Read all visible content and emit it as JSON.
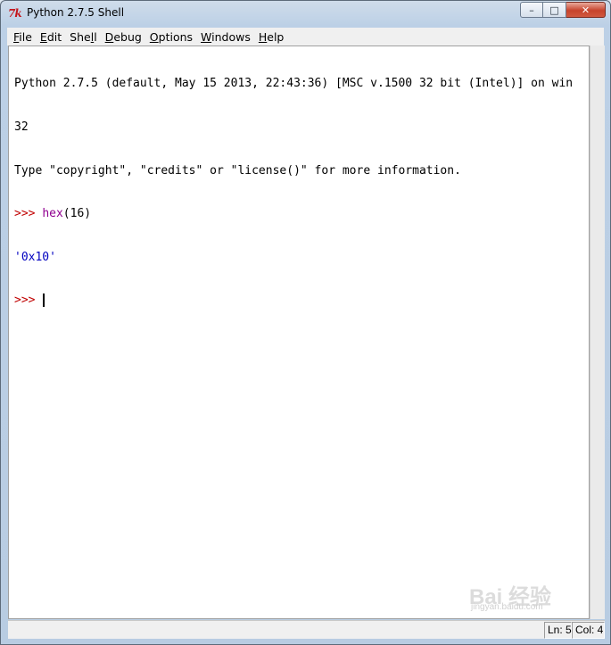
{
  "window": {
    "title": "Python 2.7.5 Shell",
    "app_icon": "tk-feather-icon",
    "controls": {
      "minimize": "minimize-icon",
      "maximize": "maximize-icon",
      "close": "close-icon"
    }
  },
  "menu": {
    "items": [
      {
        "underline": "F",
        "rest": "ile"
      },
      {
        "underline": "E",
        "rest": "dit"
      },
      {
        "prefix": "She",
        "underline": "l",
        "rest": "l"
      },
      {
        "underline": "D",
        "rest": "ebug"
      },
      {
        "underline": "O",
        "rest": "ptions"
      },
      {
        "underline": "W",
        "rest": "indows"
      },
      {
        "underline": "H",
        "rest": "elp"
      }
    ]
  },
  "shell": {
    "banner_line1": "Python 2.7.5 (default, May 15 2013, 22:43:36) [MSC v.1500 32 bit (Intel)] on win",
    "banner_line2": "32",
    "banner_line3": "Type \"copyright\", \"credits\" or \"license()\" for more information.",
    "prompt": ">>> ",
    "cmd_builtin": "hex",
    "cmd_args": "(16)",
    "result": "'0x10'",
    "prompt2": ">>> "
  },
  "status": {
    "line": "Ln: 5",
    "col": "Col: 4"
  },
  "watermark": {
    "main": "Bai 经验",
    "sub": "jingyan.baidu.com"
  },
  "colors": {
    "prompt": "#c00000",
    "builtin": "#900090",
    "output": "#0000c0"
  }
}
